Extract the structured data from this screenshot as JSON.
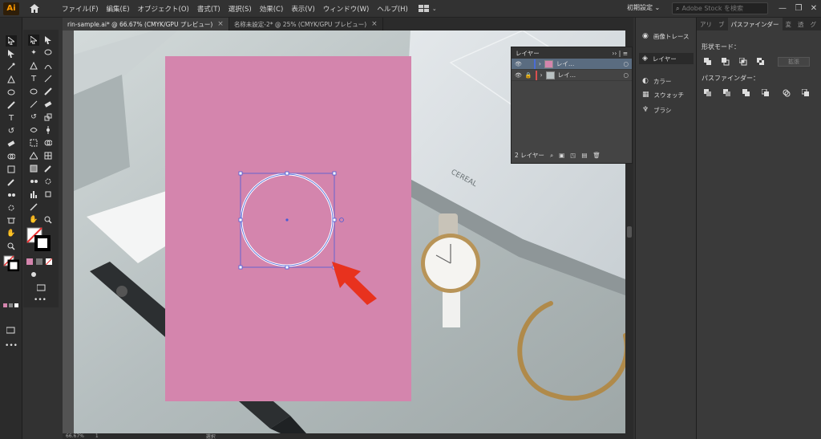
{
  "app": {
    "logo": "Ai"
  },
  "menu": [
    "ファイル(F)",
    "編集(E)",
    "オブジェクト(O)",
    "書式(T)",
    "選択(S)",
    "効果(C)",
    "表示(V)",
    "ウィンドウ(W)",
    "ヘルプ(H)"
  ],
  "workspace": "初期設定",
  "search": {
    "placeholder": "Adobe Stock を検索"
  },
  "tabs": [
    {
      "label": "rin-sample.ai* @ 66.67% (CMYK/GPU プレビュー)",
      "close": "×"
    },
    {
      "label": "名称未設定-2* @ 25% (CMYK/GPU プレビュー)",
      "close": "×"
    }
  ],
  "layers_panel": {
    "title": "レイヤー",
    "layers": [
      {
        "name": "レイ…",
        "color": "#d485ad"
      },
      {
        "name": "レイ…",
        "color": "#d94f4f"
      }
    ],
    "count_label": "2 レイヤー"
  },
  "dock": {
    "items": [
      "画像トレース",
      "レイヤー",
      "カラー",
      "スウォッチ",
      "ブラシ"
    ]
  },
  "right_panel": {
    "tabs": [
      "アリ",
      "ブ",
      "パスファインダー",
      "変",
      "透",
      "グ"
    ],
    "shape_mode_label": "形状モード：",
    "expand_label": "拡張",
    "pathfinder_label": "パスファインダー："
  },
  "status": {
    "zoom": "66.67%",
    "page": "1",
    "mode": "選択"
  },
  "colors": {
    "artboard": "#d485ad",
    "selection": "#4a5bd6",
    "arrow": "#e8321e"
  }
}
